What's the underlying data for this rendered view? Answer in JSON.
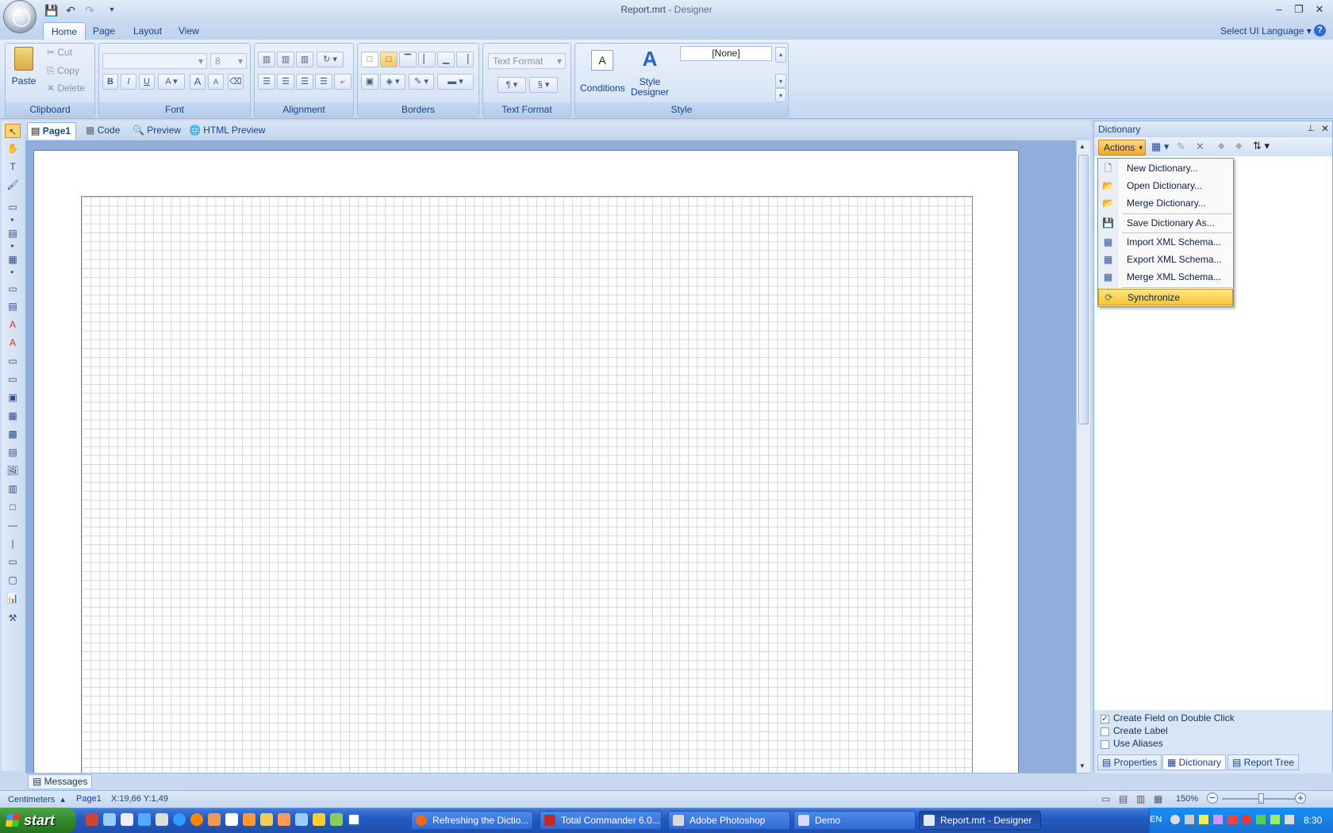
{
  "window": {
    "title": "Report.mrt",
    "title_suffix": " - Designer",
    "controls": {
      "minimize": "–",
      "restore": "❐",
      "close": "✕"
    }
  },
  "quick_access": {
    "save": "💾",
    "undo": "↶",
    "redo": "↷",
    "customize": "▾"
  },
  "ribbon_tabs": [
    {
      "label": "Home",
      "active": true
    },
    {
      "label": "Page",
      "active": false
    },
    {
      "label": "Layout",
      "active": false
    },
    {
      "label": "View",
      "active": false
    }
  ],
  "ui_language": {
    "label": "Select UI Language",
    "arrow": "▾",
    "help": "?"
  },
  "clipboard": {
    "group_label": "Clipboard",
    "paste": "Paste",
    "cut": "Cut",
    "copy": "Copy",
    "delete": "Delete"
  },
  "font": {
    "group_label": "Font",
    "family_value": "",
    "size_value": "8",
    "bold": "B",
    "italic": "I",
    "underline": "U",
    "color": "A",
    "grow": "A",
    "shrink": "A"
  },
  "alignment": {
    "group_label": "Alignment"
  },
  "borders": {
    "group_label": "Borders"
  },
  "text_format": {
    "group_label": "Text Format",
    "value": "Text Format"
  },
  "style": {
    "group_label": "Style",
    "conditions": "Conditions",
    "style_designer_line1": "Style",
    "style_designer_line2": "Designer",
    "style_value": "[None]"
  },
  "doc_tabs": [
    {
      "label": "Page1",
      "active": true,
      "icon": "page-icon"
    },
    {
      "label": "Code",
      "active": false,
      "icon": "code-icon"
    },
    {
      "label": "Preview",
      "active": false,
      "icon": "preview-icon"
    },
    {
      "label": "HTML Preview",
      "active": false,
      "icon": "html-preview-icon"
    }
  ],
  "dictionary": {
    "title": "Dictionary",
    "pin": "📌",
    "close": "✕",
    "actions_label": "Actions",
    "menu": [
      {
        "label": "New Dictionary...",
        "icon": "new-dictionary-icon",
        "selected": false
      },
      {
        "label": "Open Dictionary...",
        "icon": "open-dictionary-icon",
        "selected": false
      },
      {
        "label": "Merge Dictionary...",
        "icon": "merge-dictionary-icon",
        "selected": false
      },
      {
        "label": "Save Dictionary As...",
        "icon": "save-dictionary-icon",
        "selected": false
      },
      {
        "label": "Import XML Schema...",
        "icon": "import-xml-icon",
        "selected": false
      },
      {
        "label": "Export XML Schema...",
        "icon": "export-xml-icon",
        "selected": false
      },
      {
        "label": "Merge XML Schema...",
        "icon": "merge-xml-icon",
        "selected": false
      },
      {
        "label": "Synchronize",
        "icon": "synchronize-icon",
        "selected": true
      }
    ],
    "options": [
      {
        "label": "Create Field on Double Click",
        "checked": true
      },
      {
        "label": "Create Label",
        "checked": false
      },
      {
        "label": "Use Aliases",
        "checked": false
      }
    ],
    "bottom_tabs": [
      {
        "label": "Properties",
        "active": false
      },
      {
        "label": "Dictionary",
        "active": true
      },
      {
        "label": "Report Tree",
        "active": false
      }
    ]
  },
  "messages_tab": "Messages",
  "status": {
    "units": "Centimeters",
    "units_arrow": "▴",
    "page": "Page1",
    "coords": "X:19,66  Y:1,49",
    "zoom": "150%",
    "zoom_minus": "−",
    "zoom_plus": "+"
  },
  "taskbar": {
    "start": "start",
    "buttons": [
      {
        "label": "Refreshing the Dictio...",
        "active": false,
        "color": "#e86a1a"
      },
      {
        "label": "Total Commander 6.0...",
        "active": false,
        "color": "#c0282c"
      },
      {
        "label": "Adobe Photoshop",
        "active": false,
        "color": "#d8d8d8"
      },
      {
        "label": "Demo",
        "active": false,
        "color": "#d8d8f8"
      },
      {
        "label": "Report.mrt - Designer",
        "active": true,
        "color": "#dfe8f5"
      }
    ],
    "lang": "EN",
    "clock": "8:30"
  },
  "colors": {
    "ribbon_text": "#15428b",
    "menu_highlight": "#f8c630",
    "actions_button": "#f5a623",
    "taskbar_blue": "#245bc2"
  }
}
